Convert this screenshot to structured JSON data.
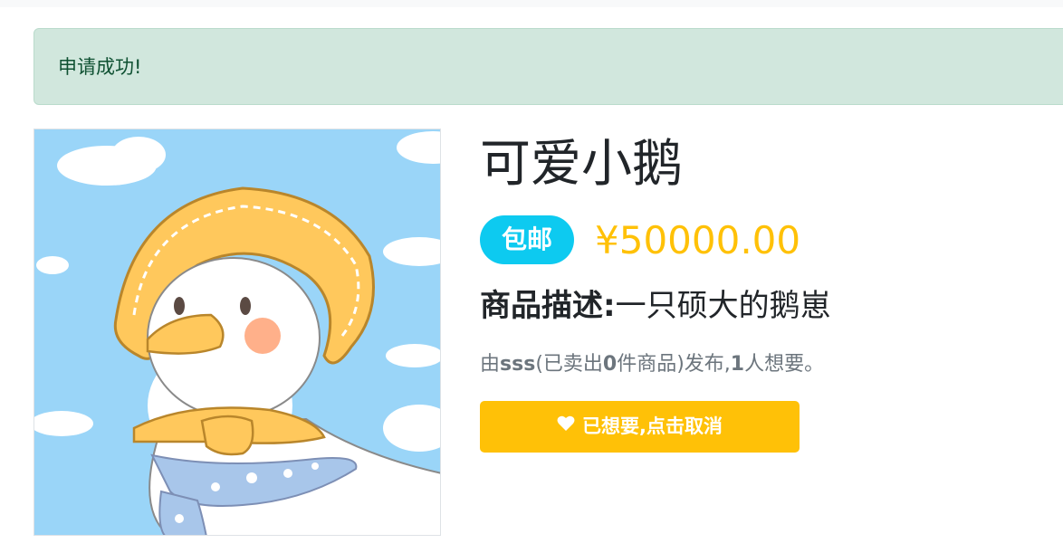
{
  "alert": {
    "message": "申请成功!"
  },
  "product": {
    "title": "可爱小鹅",
    "shipping_badge": "包邮",
    "price": "¥50000.00",
    "description_label": "商品描述:",
    "description": "一只硕大的鹅崽",
    "seller": {
      "prefix": "由",
      "name": "sss",
      "sold_prefix": "(已卖出",
      "sold_count": "0",
      "sold_suffix": "件商品)发布,",
      "want_count": "1",
      "want_suffix": "人想要。"
    },
    "want_button_label": "已想要,点击取消",
    "image_icon": "goose-illustration"
  },
  "colors": {
    "alert_bg": "#d1e7dd",
    "alert_text": "#0f5132",
    "badge": "#0dcaf0",
    "price": "#ffc107",
    "button": "#ffc107"
  }
}
